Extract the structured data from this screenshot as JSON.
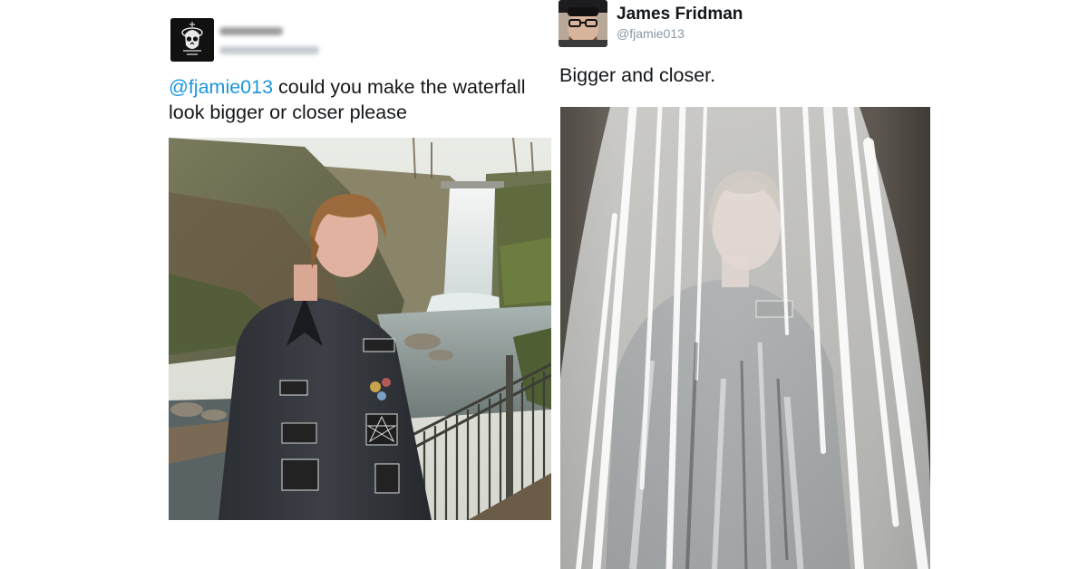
{
  "left_tweet": {
    "mention": "@fjamie013",
    "text": " could you make the waterfall look bigger or closer please",
    "avatar": "skull-avatar-icon",
    "photo": "person-with-waterfall-photo"
  },
  "right_tweet": {
    "display_name": "James Fridman",
    "handle": "@fjamie013",
    "text": "Bigger and closer.",
    "avatar": "man-with-glasses-avatar",
    "photo": "person-under-waterfall-photo"
  },
  "colors": {
    "mention": "#1b95e0",
    "text": "#14171a",
    "handle": "#8899a6"
  }
}
